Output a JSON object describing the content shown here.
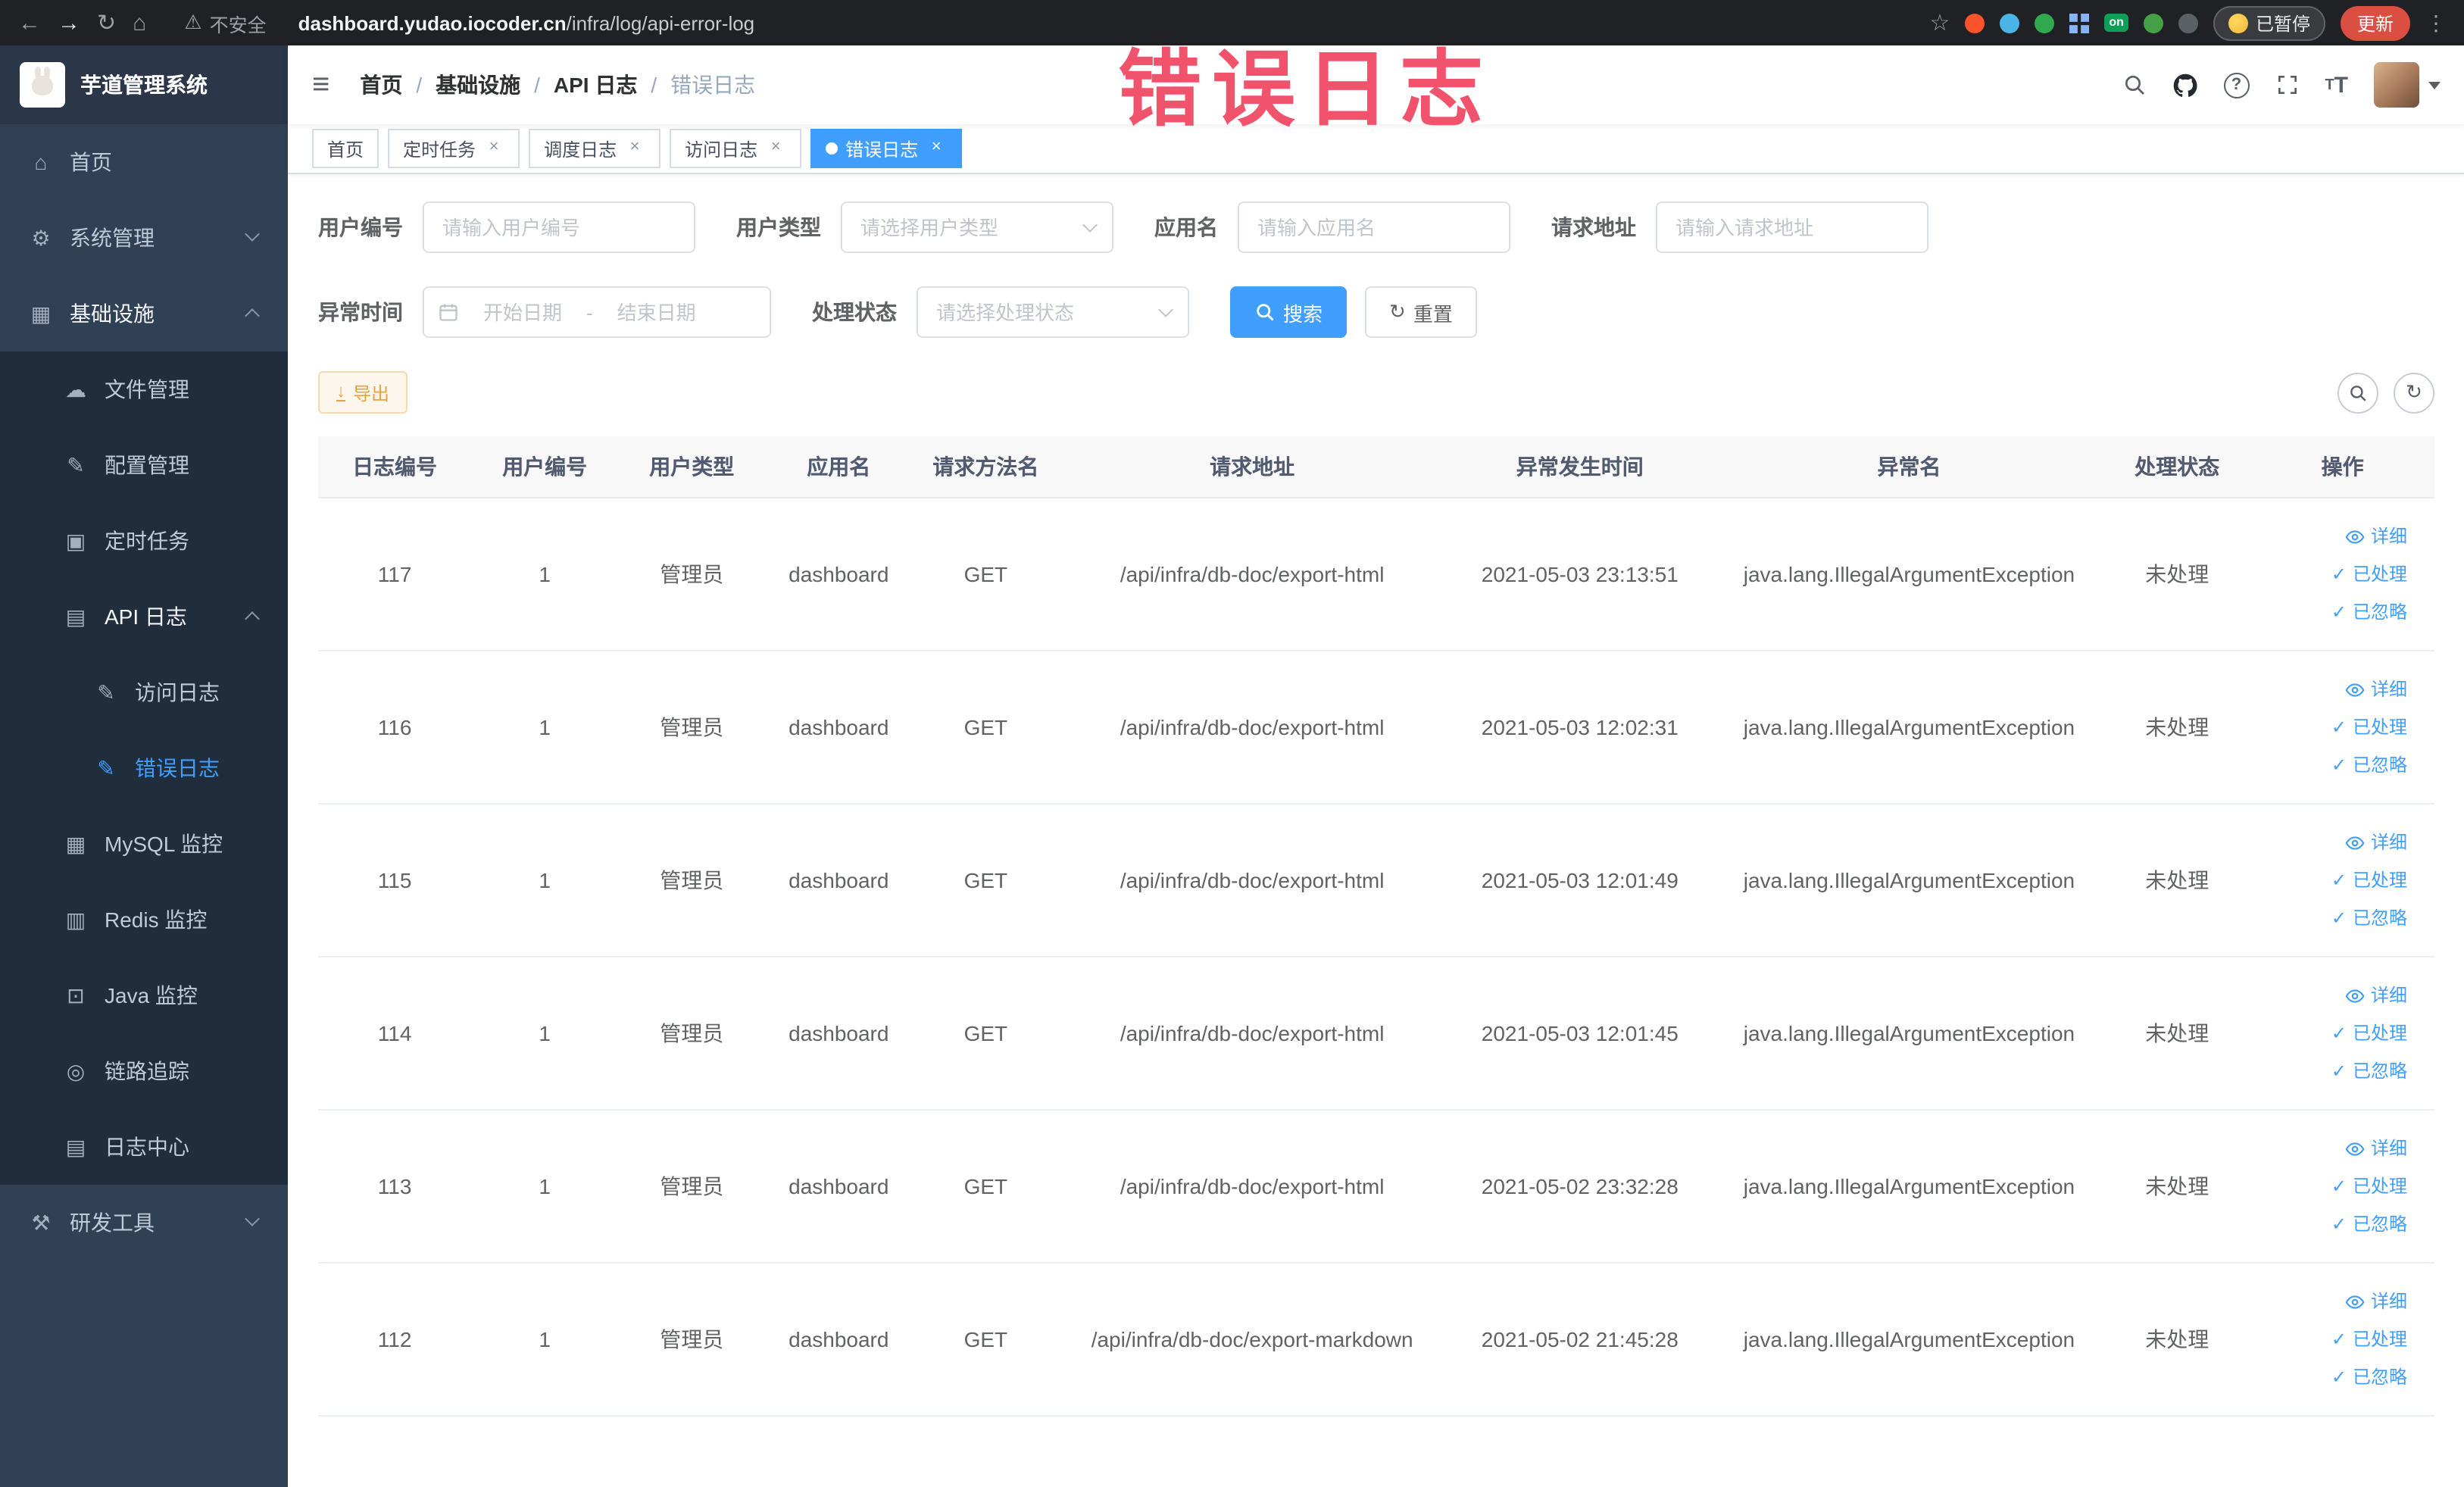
{
  "colors": {
    "accent": "#409eff",
    "sidebar_bg": "#304156",
    "submenu_bg": "#1f2d3d",
    "warning": "#e6a23c",
    "annotation": "#f0536b"
  },
  "browser": {
    "security_label": "不安全",
    "url_domain": "dashboard.yudao.iocoder.cn",
    "url_path": "/infra/log/api-error-log",
    "on_badge": "on",
    "paused_badge": "已暂停",
    "update_button": "更新"
  },
  "annotation": {
    "text": "错误日志"
  },
  "icons": {
    "back": "←",
    "forward": "→",
    "reload": "↻",
    "browser_home": "⌂",
    "warning": "⚠",
    "star": "☆",
    "kebab": "⋮",
    "hamburger": "≡",
    "download": "↓",
    "refresh": "↻",
    "check": "✓",
    "close": "×",
    "home": "⌂",
    "gear": "⚙",
    "infra": "▦",
    "file": "☁",
    "config": "✎",
    "job": "▣",
    "api": "▤",
    "log_edit": "✎",
    "mysql": "▦",
    "redis": "▥",
    "java": "⊡",
    "trace": "◎",
    "log_center": "▤",
    "tools": "⚒"
  },
  "sidebar": {
    "logo_title": "芋道管理系统",
    "items": [
      {
        "label": "首页"
      },
      {
        "label": "系统管理"
      },
      {
        "label": "基础设施"
      },
      {
        "label": "文件管理"
      },
      {
        "label": "配置管理"
      },
      {
        "label": "定时任务"
      },
      {
        "label": "API 日志"
      },
      {
        "label": "访问日志"
      },
      {
        "label": "错误日志"
      },
      {
        "label": "MySQL 监控"
      },
      {
        "label": "Redis 监控"
      },
      {
        "label": "Java 监控"
      },
      {
        "label": "链路追踪"
      },
      {
        "label": "日志中心"
      },
      {
        "label": "研发工具"
      }
    ]
  },
  "breadcrumb": {
    "separator": "/",
    "items": [
      "首页",
      "基础设施",
      "API 日志",
      "错误日志"
    ]
  },
  "tags": [
    {
      "label": "首页"
    },
    {
      "label": "定时任务"
    },
    {
      "label": "调度日志"
    },
    {
      "label": "访问日志"
    },
    {
      "label": "错误日志"
    }
  ],
  "filters": {
    "user_id_label": "用户编号",
    "user_id_placeholder": "请输入用户编号",
    "user_type_label": "用户类型",
    "user_type_placeholder": "请选择用户类型",
    "app_label": "应用名",
    "app_placeholder": "请输入应用名",
    "url_label": "请求地址",
    "url_placeholder": "请输入请求地址",
    "time_label": "异常时间",
    "time_start_placeholder": "开始日期",
    "time_separator": "-",
    "time_end_placeholder": "结束日期",
    "status_label": "处理状态",
    "status_placeholder": "请选择处理状态",
    "search_label": "搜索",
    "reset_label": "重置"
  },
  "toolbar": {
    "export_label": "导出"
  },
  "table": {
    "headers": [
      "日志编号",
      "用户编号",
      "用户类型",
      "应用名",
      "请求方法名",
      "请求地址",
      "异常发生时间",
      "异常名",
      "处理状态",
      "操作"
    ],
    "ops": {
      "detail": "详细",
      "processed": "已处理",
      "ignored": "已忽略"
    },
    "rows": [
      {
        "id": "117",
        "user_id": "1",
        "user_type": "管理员",
        "app": "dashboard",
        "method": "GET",
        "url": "/api/infra/db-doc/export-html",
        "time": "2021-05-03 23:13:51",
        "exception": "java.lang.IllegalArgumentException",
        "status": "未处理"
      },
      {
        "id": "116",
        "user_id": "1",
        "user_type": "管理员",
        "app": "dashboard",
        "method": "GET",
        "url": "/api/infra/db-doc/export-html",
        "time": "2021-05-03 12:02:31",
        "exception": "java.lang.IllegalArgumentException",
        "status": "未处理"
      },
      {
        "id": "115",
        "user_id": "1",
        "user_type": "管理员",
        "app": "dashboard",
        "method": "GET",
        "url": "/api/infra/db-doc/export-html",
        "time": "2021-05-03 12:01:49",
        "exception": "java.lang.IllegalArgumentException",
        "status": "未处理"
      },
      {
        "id": "114",
        "user_id": "1",
        "user_type": "管理员",
        "app": "dashboard",
        "method": "GET",
        "url": "/api/infra/db-doc/export-html",
        "time": "2021-05-03 12:01:45",
        "exception": "java.lang.IllegalArgumentException",
        "status": "未处理"
      },
      {
        "id": "113",
        "user_id": "1",
        "user_type": "管理员",
        "app": "dashboard",
        "method": "GET",
        "url": "/api/infra/db-doc/export-html",
        "time": "2021-05-02 23:32:28",
        "exception": "java.lang.IllegalArgumentException",
        "status": "未处理"
      },
      {
        "id": "112",
        "user_id": "1",
        "user_type": "管理员",
        "app": "dashboard",
        "method": "GET",
        "url": "/api/infra/db-doc/export-markdown",
        "time": "2021-05-02 21:45:28",
        "exception": "java.lang.IllegalArgumentException",
        "status": "未处理"
      }
    ]
  }
}
